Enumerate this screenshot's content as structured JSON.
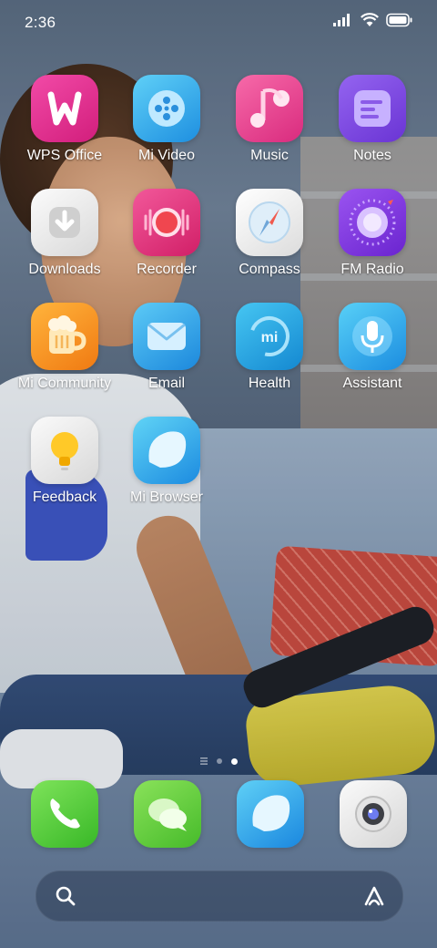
{
  "status_bar": {
    "time": "2:36",
    "icons": [
      "signal-icon",
      "wifi-icon",
      "battery-icon"
    ]
  },
  "apps": [
    {
      "label": "WPS Office",
      "icon": "wps-office-icon",
      "color": "#e2308f"
    },
    {
      "label": "Mi Video",
      "icon": "mi-video-icon",
      "color": "#29a6e8"
    },
    {
      "label": "Music",
      "icon": "music-icon",
      "color": "#ea3f92"
    },
    {
      "label": "Notes",
      "icon": "notes-icon",
      "color": "#7b4de0"
    },
    {
      "label": "Downloads",
      "icon": "downloads-icon",
      "color": "#e9e9e9"
    },
    {
      "label": "Recorder",
      "icon": "recorder-icon",
      "color": "#e53a7a"
    },
    {
      "label": "Compass",
      "icon": "compass-icon",
      "color": "#f1f1f1"
    },
    {
      "label": "FM Radio",
      "icon": "fm-radio-icon",
      "color": "#7e3cdc"
    },
    {
      "label": "Mi Community",
      "icon": "mi-community-icon",
      "color": "#f59a1e"
    },
    {
      "label": "Email",
      "icon": "email-icon",
      "color": "#2ea0e6"
    },
    {
      "label": "Health",
      "icon": "health-icon",
      "color": "#1ea3d8"
    },
    {
      "label": "Assistant",
      "icon": "assistant-icon",
      "color": "#2aa4e4"
    },
    {
      "label": "Feedback",
      "icon": "feedback-icon",
      "color": "#eaeaea"
    },
    {
      "label": "Mi Browser",
      "icon": "mi-browser-icon",
      "color": "#2fb0e6"
    }
  ],
  "page_indicator": {
    "pages": 2,
    "current": 2
  },
  "dock": [
    {
      "icon": "phone-icon",
      "color": "#4fd03b"
    },
    {
      "icon": "messages-icon",
      "color": "#63d13a"
    },
    {
      "icon": "browser-icon",
      "color": "#2aa7e8"
    },
    {
      "icon": "camera-icon",
      "color": "#e4e4e4"
    }
  ],
  "search_bar": {
    "icons": [
      "search-icon",
      "assistant-a-icon"
    ]
  }
}
